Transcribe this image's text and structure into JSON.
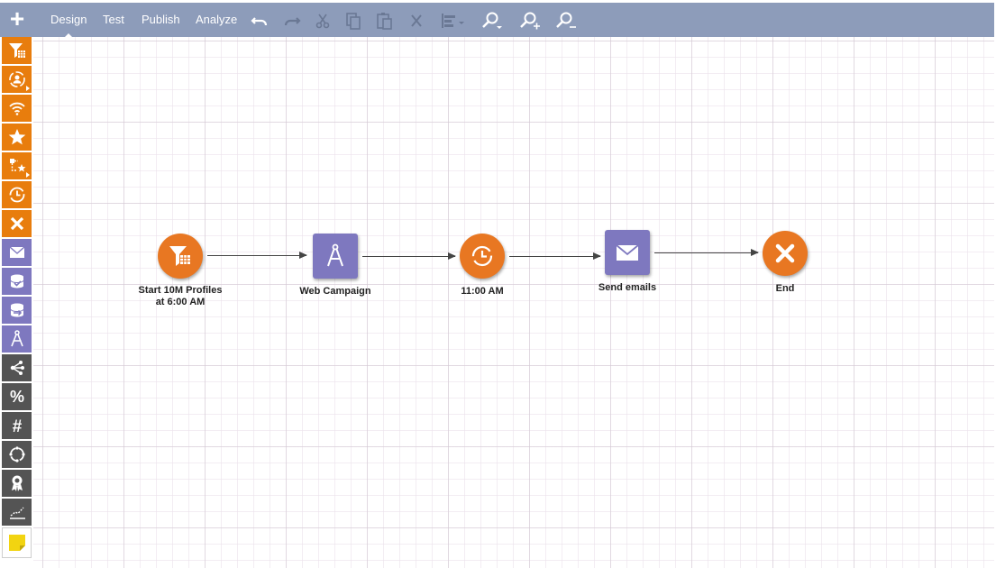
{
  "toolbar": {
    "menu": {
      "design": "Design",
      "test": "Test",
      "publish": "Publish",
      "analyze": "Analyze"
    },
    "active_tab": "Design",
    "tools": [
      "undo-icon",
      "redo-icon",
      "cut-icon",
      "copy-icon",
      "paste-icon",
      "delete-icon",
      "align-icon",
      "zoom-fit-icon",
      "zoom-in-icon",
      "zoom-out-icon"
    ]
  },
  "palette": {
    "items": [
      {
        "icon": "filter-segment-icon",
        "group": "orange"
      },
      {
        "icon": "audience-icon",
        "group": "orange"
      },
      {
        "icon": "signal-icon",
        "group": "orange"
      },
      {
        "icon": "star-icon",
        "group": "orange"
      },
      {
        "icon": "flow-star-icon",
        "group": "orange"
      },
      {
        "icon": "timer-icon",
        "group": "orange"
      },
      {
        "icon": "end-icon",
        "group": "orange"
      },
      {
        "icon": "email-icon",
        "group": "purple"
      },
      {
        "icon": "database-check-icon",
        "group": "purple"
      },
      {
        "icon": "database-export-icon",
        "group": "purple"
      },
      {
        "icon": "compass-icon",
        "group": "purple"
      },
      {
        "icon": "split-icon",
        "group": "dark"
      },
      {
        "icon": "percent-icon",
        "group": "dark"
      },
      {
        "icon": "hash-icon",
        "group": "dark"
      },
      {
        "icon": "cycle-icon",
        "group": "dark"
      },
      {
        "icon": "award-icon",
        "group": "dark"
      },
      {
        "icon": "chart-line-icon",
        "group": "dark"
      },
      {
        "icon": "note-icon",
        "group": "note"
      }
    ]
  },
  "workflow": {
    "nodes": [
      {
        "id": "start",
        "label": "Start 10M Profiles at 6:00 AM",
        "icon": "filter-segment-icon",
        "color": "#e87722"
      },
      {
        "id": "web",
        "label": "Web Campaign",
        "icon": "compass-icon",
        "color": "#7e78bf"
      },
      {
        "id": "wait",
        "label": "11:00 AM",
        "icon": "timer-icon",
        "color": "#e87722"
      },
      {
        "id": "email",
        "label": "Send emails",
        "icon": "email-icon",
        "color": "#7e78bf"
      },
      {
        "id": "end",
        "label": "End",
        "icon": "end-icon",
        "color": "#e87722"
      }
    ]
  },
  "colors": {
    "toolbar": "#8d9cba",
    "orange": "#e87722",
    "purple": "#7e78bf",
    "dark": "#545454"
  }
}
